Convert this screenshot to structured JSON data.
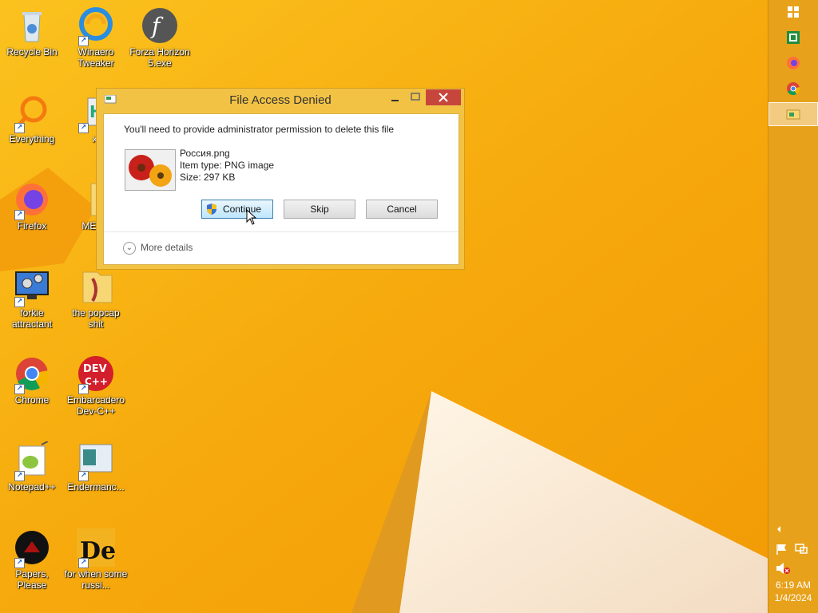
{
  "desktop": {
    "icons": [
      {
        "label": "Recycle Bin"
      },
      {
        "label": "Winaero Tweaker"
      },
      {
        "label": "Forza Horizon 5.exe"
      },
      {
        "label": "Everything"
      },
      {
        "label": "xl"
      },
      {
        "label": "Firefox"
      },
      {
        "label": "MEMZ"
      },
      {
        "label": "forkie attractant"
      },
      {
        "label": "the popcap shit"
      },
      {
        "label": "Chrome"
      },
      {
        "label": "Embarcadero Dev-C++"
      },
      {
        "label": "Notepad++"
      },
      {
        "label": "Endermanc..."
      },
      {
        "label": "Papers, Please"
      },
      {
        "label": "for when some russi..."
      }
    ]
  },
  "dialog": {
    "title": "File Access Denied",
    "message": "You'll need to provide administrator permission to delete this file",
    "file": {
      "name": "Россия.png",
      "type": "Item type: PNG image",
      "size": "Size: 297 KB"
    },
    "buttons": {
      "continue": "Continue",
      "skip": "Skip",
      "cancel": "Cancel"
    },
    "more_details": "More details"
  },
  "taskbar": {
    "time": "6:19 AM",
    "date": "1/4/2024"
  },
  "colors": {
    "wallpaper": "#f6ae10",
    "close_button": "#c7463c",
    "taskbar": "#e8a11a"
  }
}
